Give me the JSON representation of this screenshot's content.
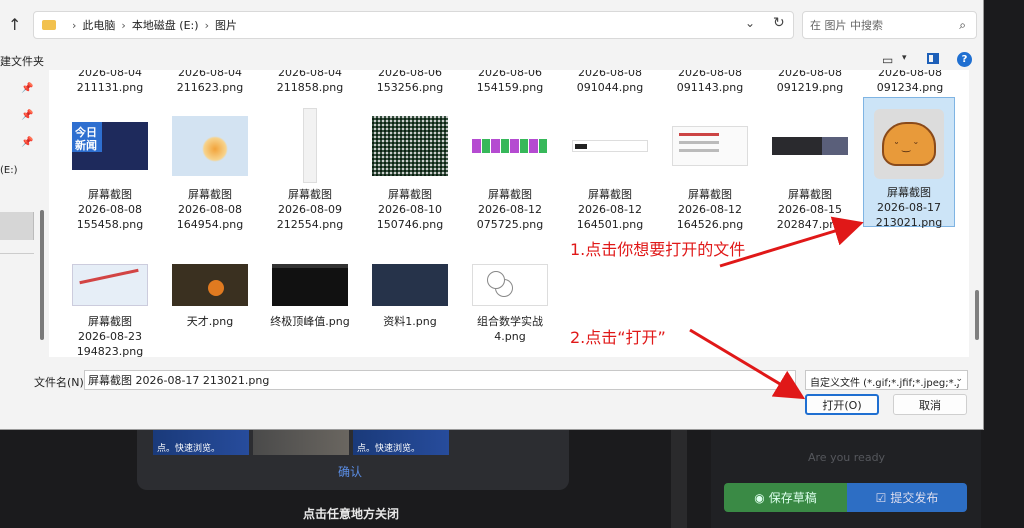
{
  "background": {
    "confirm_label": "确认",
    "close_label": "点击任意地方关闭",
    "strip_captions": [
      "点。快速浏览。",
      "",
      "点。快速浏览。"
    ],
    "ready_text": "Are you ready",
    "save_draft_label": "保存草稿",
    "submit_label": "提交发布"
  },
  "dialog": {
    "breadcrumbs": [
      "此电脑",
      "本地磁盘 (E:)",
      "图片"
    ],
    "search_placeholder": "在 图片 中搜索",
    "new_folder_label": "建文件夹",
    "nav_drive_label": "(E:)",
    "top_row_files": [
      {
        "date": "2026-08-04",
        "num": "211131.png"
      },
      {
        "date": "2026-08-04",
        "num": "211623.png"
      },
      {
        "date": "2026-08-04",
        "num": "211858.png"
      },
      {
        "date": "2026-08-06",
        "num": "153256.png"
      },
      {
        "date": "2026-08-06",
        "num": "154159.png"
      },
      {
        "date": "2026-08-08",
        "num": "091044.png"
      },
      {
        "date": "2026-08-08",
        "num": "091143.png"
      },
      {
        "date": "2026-08-08",
        "num": "091219.png"
      },
      {
        "date": "2026-08-08",
        "num": "091234.png"
      }
    ],
    "files": [
      {
        "l1": "屏幕截图",
        "l2": "2026-08-08",
        "l3": "155458.png"
      },
      {
        "l1": "屏幕截图",
        "l2": "2026-08-08",
        "l3": "164954.png"
      },
      {
        "l1": "屏幕截图",
        "l2": "2026-08-09",
        "l3": "212554.png"
      },
      {
        "l1": "屏幕截图",
        "l2": "2026-08-10",
        "l3": "150746.png"
      },
      {
        "l1": "屏幕截图",
        "l2": "2026-08-12",
        "l3": "075725.png"
      },
      {
        "l1": "屏幕截图",
        "l2": "2026-08-12",
        "l3": "164501.png"
      },
      {
        "l1": "屏幕截图",
        "l2": "2026-08-12",
        "l3": "164526.png"
      },
      {
        "l1": "屏幕截图",
        "l2": "2026-08-15",
        "l3": "202847.png"
      },
      {
        "l1": "屏幕截图",
        "l2": "2026-08-17",
        "l3": "213021.png"
      },
      {
        "l1": "屏幕截图",
        "l2": "2026-08-23",
        "l3": "194823.png"
      },
      {
        "l1": "天才.png"
      },
      {
        "l1": "终极顶峰值.png"
      },
      {
        "l1": "资料1.png"
      },
      {
        "l1": "组合数学实战",
        "l2": "4.png"
      }
    ],
    "thumb_news_text": "今日\n新闻",
    "filename_label": "文件名(N):",
    "filename_value": "屏幕截图 2026-08-17 213021.png",
    "filetype_value": "自定义文件 (*.gif;*.jfif;*.jpeg;*.j",
    "open_label": "打开(O)",
    "cancel_label": "取消"
  },
  "annotations": {
    "step1": "1.点击你想要打开的文件",
    "step2": "2.点击“打开”",
    "color": "#e01818"
  },
  "colors": {
    "accent": "#1f6fd1",
    "selection": "#cce4f7",
    "save_green": "#3a8a45",
    "submit_blue": "#2d6ec4"
  }
}
